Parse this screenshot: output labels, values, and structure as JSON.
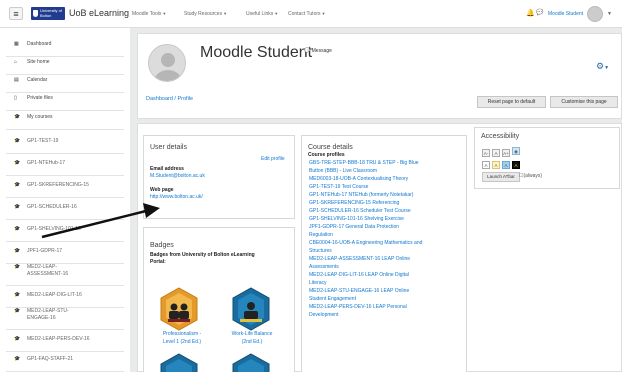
{
  "navbar": {
    "logo_text": "University of Bolton",
    "brand": "UoB eLearning",
    "menus": [
      "Moodle Tools",
      "Study Resources",
      "Useful Links",
      "Contact Tutors"
    ],
    "user_name": "Moodle Student"
  },
  "drawer": {
    "items": [
      {
        "icon": "dashboard-icon",
        "label": "Dashboard"
      },
      {
        "icon": "home-icon",
        "label": "Site home"
      },
      {
        "icon": "calendar-icon",
        "label": "Calendar"
      },
      {
        "icon": "file-icon",
        "label": "Private files"
      },
      {
        "icon": "graduation-cap-icon",
        "label": "My courses"
      },
      {
        "icon": "graduation-cap-icon",
        "label": "GP1-TEST-19"
      },
      {
        "icon": "graduation-cap-icon",
        "label": "GP1-NTEHub-17"
      },
      {
        "icon": "graduation-cap-icon",
        "label": "GP1-SKREFERENCING-15"
      },
      {
        "icon": "graduation-cap-icon",
        "label": "GP1-SCHEDULER-16"
      },
      {
        "icon": "graduation-cap-icon",
        "label": "GP1-SHELVING-101-16"
      },
      {
        "icon": "graduation-cap-icon",
        "label": "JPF1-GDPR-17"
      },
      {
        "icon": "graduation-cap-icon",
        "label": "MED2-LEAP-ASSESSMENT-16"
      },
      {
        "icon": "graduation-cap-icon",
        "label": "MED2-LEAP-DIG-LIT-16"
      },
      {
        "icon": "graduation-cap-icon",
        "label": "MED2-LEAP-STU-ENGAGE-16"
      },
      {
        "icon": "graduation-cap-icon",
        "label": "MED2-LEAP-PERS-DEV-16"
      },
      {
        "icon": "graduation-cap-icon",
        "label": "GP1-FAQ-STAFF-21"
      }
    ]
  },
  "header": {
    "title": "Moodle Student",
    "message": "Message",
    "breadcrumb": "Dashboard / Profile",
    "reset_button": "Reset page to default",
    "customise_button": "Customise this page"
  },
  "user_details": {
    "title": "User details",
    "edit_profile": "Edit profile",
    "email_label": "Email address",
    "email_value": "M.Student@bolton.ac.uk",
    "webpage_label": "Web page",
    "webpage_value": "http://www.bolton.ac.uk/"
  },
  "badges": {
    "title": "Badges",
    "subtitle_line1": "Badges from University of Bolton eLearning",
    "subtitle_line2": "Portal:",
    "items": [
      {
        "label_line1": "Professionalism -",
        "label_line2": "Level 1 (2nd Ed.)"
      },
      {
        "label_line1": "Work-Life Balance",
        "label_line2": "(2nd Ed.)"
      }
    ]
  },
  "course_details": {
    "title": "Course details",
    "subtitle": "Course profiles",
    "courses": [
      "GBS-TRE-STEP-BBB-18 TRU & STEP - Big Blue",
      "Button (BBB) - Live Classroom",
      "MED6003-18-UOB-A Contextualising Theory",
      "GP1-TEST-19 Test Course",
      "GP1-NTEHub-17 NTEHub (formerly Notetakar)",
      "GP1-SKREFERENCING-15 Referencing",
      "GP1-SCHEDULER-16 Scheduler Test Course",
      "GP1-SHELVING-101-16 Shelving Exercise",
      "JPF1-GDPR-17 General Data Protection",
      "Regulation",
      "CBE0004-16-UOB-A Engineering Mathematics and",
      "Structures",
      "MED2-LEAP-ASSESSMENT-16 LEAP Online",
      "Assessments",
      "MED2-LEAP-DIG-LIT-16 LEAP Online Digital",
      "Literacy",
      "MED2-LEAP-STU-ENGAGE-16 LEAP Online",
      "Student Engagement",
      "MED2-LEAP-PERS-DEV-16 LEAP Personal",
      "Development"
    ]
  },
  "accessibility": {
    "title": "Accessibility",
    "font_buttons": [
      "A-",
      "A",
      "A+"
    ],
    "color_buttons": [
      "A",
      "A",
      "A",
      "A"
    ],
    "launch_button": "Launch ATbar",
    "always_label": "(always)"
  }
}
